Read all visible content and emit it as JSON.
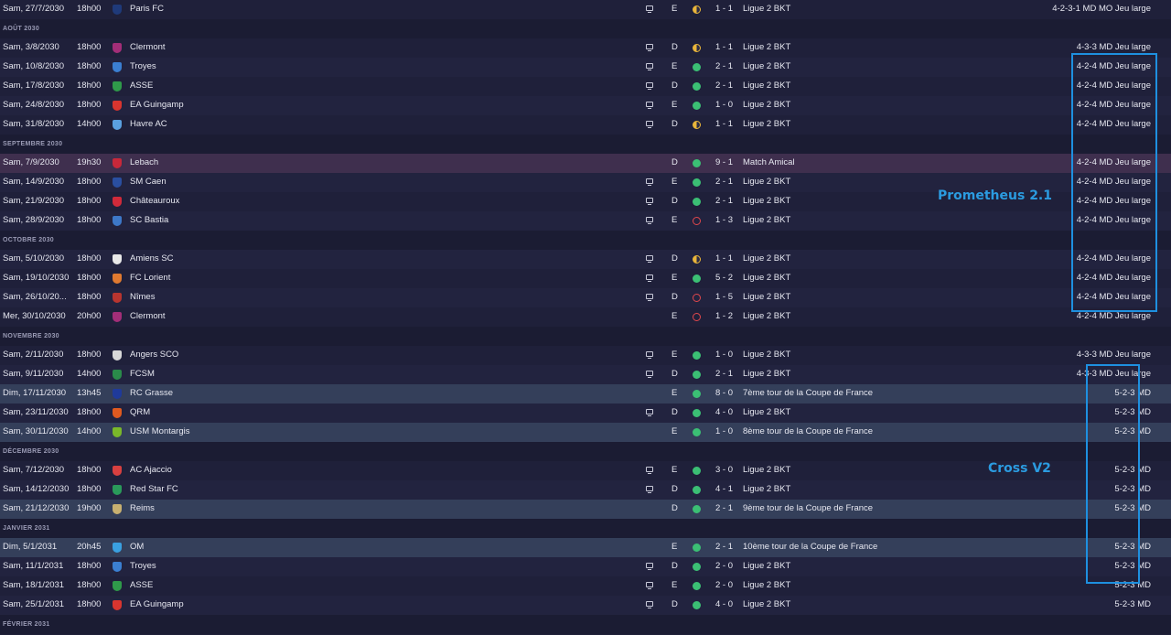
{
  "rows": [
    {
      "kind": "match",
      "date": "Sam, 27/7/2030",
      "time": "18h00",
      "crest": "#1f3a7a",
      "team": "Paris FC",
      "tv": true,
      "venue": "E",
      "result": "D",
      "score": "1 - 1",
      "comp": "Ligue 2 BKT",
      "tactic": "4-2-3-1 MD MO Jeu large"
    },
    {
      "kind": "month",
      "label": "AOÛT 2030"
    },
    {
      "kind": "match",
      "date": "Sam, 3/8/2030",
      "time": "18h00",
      "crest": "#a32e78",
      "team": "Clermont",
      "tv": true,
      "venue": "D",
      "result": "D",
      "score": "1 - 1",
      "comp": "Ligue 2 BKT",
      "tactic": "4-3-3 MD Jeu large"
    },
    {
      "kind": "match",
      "date": "Sam, 10/8/2030",
      "time": "18h00",
      "crest": "#3b7fd1",
      "team": "Troyes",
      "tv": true,
      "venue": "E",
      "result": "W",
      "score": "2 - 1",
      "comp": "Ligue 2 BKT",
      "tactic": "4-2-4 MD Jeu large"
    },
    {
      "kind": "match",
      "date": "Sam, 17/8/2030",
      "time": "18h00",
      "crest": "#2f9a4a",
      "team": "ASSE",
      "tv": true,
      "venue": "D",
      "result": "W",
      "score": "2 - 1",
      "comp": "Ligue 2 BKT",
      "tactic": "4-2-4 MD Jeu large"
    },
    {
      "kind": "match",
      "date": "Sam, 24/8/2030",
      "time": "18h00",
      "crest": "#d8352f",
      "team": "EA Guingamp",
      "tv": true,
      "venue": "E",
      "result": "W",
      "score": "1 - 0",
      "comp": "Ligue 2 BKT",
      "tactic": "4-2-4 MD Jeu large"
    },
    {
      "kind": "match",
      "date": "Sam, 31/8/2030",
      "time": "14h00",
      "crest": "#5aa0e0",
      "team": "Havre AC",
      "tv": true,
      "venue": "D",
      "result": "D",
      "score": "1 - 1",
      "comp": "Ligue 2 BKT",
      "tactic": "4-2-4 MD Jeu large"
    },
    {
      "kind": "month",
      "label": "SEPTEMBRE 2030"
    },
    {
      "kind": "match",
      "style": "friendly",
      "date": "Sam, 7/9/2030",
      "time": "19h30",
      "crest": "#c8283a",
      "team": "Lebach",
      "tv": false,
      "venue": "D",
      "result": "W",
      "score": "9 - 1",
      "comp": "Match Amical",
      "tactic": "4-2-4 MD Jeu large"
    },
    {
      "kind": "match",
      "date": "Sam, 14/9/2030",
      "time": "18h00",
      "crest": "#2a4fa0",
      "team": "SM Caen",
      "tv": true,
      "venue": "E",
      "result": "W",
      "score": "2 - 1",
      "comp": "Ligue 2 BKT",
      "tactic": "4-2-4 MD Jeu large"
    },
    {
      "kind": "match",
      "date": "Sam, 21/9/2030",
      "time": "18h00",
      "crest": "#d02a3a",
      "team": "Châteauroux",
      "tv": true,
      "venue": "D",
      "result": "W",
      "score": "2 - 1",
      "comp": "Ligue 2 BKT",
      "tactic": "4-2-4 MD Jeu large"
    },
    {
      "kind": "match",
      "date": "Sam, 28/9/2030",
      "time": "18h00",
      "crest": "#3d78c8",
      "team": "SC Bastia",
      "tv": true,
      "venue": "E",
      "result": "L",
      "score": "1 - 3",
      "comp": "Ligue 2 BKT",
      "tactic": "4-2-4 MD Jeu large"
    },
    {
      "kind": "month",
      "label": "OCTOBRE 2030"
    },
    {
      "kind": "match",
      "date": "Sam, 5/10/2030",
      "time": "18h00",
      "crest": "#e8e8e8",
      "team": "Amiens SC",
      "tv": true,
      "venue": "D",
      "result": "D",
      "score": "1 - 1",
      "comp": "Ligue 2 BKT",
      "tactic": "4-2-4 MD Jeu large"
    },
    {
      "kind": "match",
      "date": "Sam, 19/10/2030",
      "time": "18h00",
      "crest": "#e07a30",
      "team": "FC Lorient",
      "tv": true,
      "venue": "E",
      "result": "W",
      "score": "5 - 2",
      "comp": "Ligue 2 BKT",
      "tactic": "4-2-4 MD Jeu large"
    },
    {
      "kind": "match",
      "date": "Sam, 26/10/20...",
      "time": "18h00",
      "crest": "#b8352f",
      "team": "Nîmes",
      "tv": true,
      "venue": "D",
      "result": "L",
      "score": "1 - 5",
      "comp": "Ligue 2 BKT",
      "tactic": "4-2-4 MD Jeu large"
    },
    {
      "kind": "match",
      "date": "Mer, 30/10/2030",
      "time": "20h00",
      "crest": "#a32e78",
      "team": "Clermont",
      "tv": false,
      "venue": "E",
      "result": "L",
      "score": "1 - 2",
      "comp": "Ligue 2 BKT",
      "tactic": "4-2-4 MD Jeu large"
    },
    {
      "kind": "month",
      "label": "NOVEMBRE 2030"
    },
    {
      "kind": "match",
      "date": "Sam, 2/11/2030",
      "time": "18h00",
      "crest": "#d8d8d8",
      "team": "Angers SCO",
      "tv": true,
      "venue": "E",
      "result": "W",
      "score": "1 - 0",
      "comp": "Ligue 2 BKT",
      "tactic": "4-3-3 MD Jeu large"
    },
    {
      "kind": "match",
      "date": "Sam, 9/11/2030",
      "time": "14h00",
      "crest": "#2a8a4a",
      "team": "FCSM",
      "tv": true,
      "venue": "D",
      "result": "W",
      "score": "2 - 1",
      "comp": "Ligue 2 BKT",
      "tactic": "4-3-3 MD Jeu large"
    },
    {
      "kind": "match",
      "style": "cup",
      "date": "Dim, 17/11/2030",
      "time": "13h45",
      "crest": "#1f3a9a",
      "team": "RC Grasse",
      "tv": false,
      "venue": "E",
      "result": "W",
      "score": "8 - 0",
      "comp": "7ème tour de la Coupe de France",
      "tactic": "5-2-3 MD"
    },
    {
      "kind": "match",
      "date": "Sam, 23/11/2030",
      "time": "18h00",
      "crest": "#e05a20",
      "team": "QRM",
      "tv": true,
      "venue": "D",
      "result": "W",
      "score": "4 - 0",
      "comp": "Ligue 2 BKT",
      "tactic": "5-2-3 MD"
    },
    {
      "kind": "match",
      "style": "cup",
      "date": "Sam, 30/11/2030",
      "time": "14h00",
      "crest": "#7ab82a",
      "team": "USM Montargis",
      "tv": false,
      "venue": "E",
      "result": "W",
      "score": "1 - 0",
      "comp": "8ème tour de la Coupe de France",
      "tactic": "5-2-3 MD"
    },
    {
      "kind": "month",
      "label": "DÉCEMBRE 2030"
    },
    {
      "kind": "match",
      "date": "Sam, 7/12/2030",
      "time": "18h00",
      "crest": "#d84040",
      "team": "AC Ajaccio",
      "tv": true,
      "venue": "E",
      "result": "W",
      "score": "3 - 0",
      "comp": "Ligue 2 BKT",
      "tactic": "5-2-3 MD"
    },
    {
      "kind": "match",
      "date": "Sam, 14/12/2030",
      "time": "18h00",
      "crest": "#2a9a5a",
      "team": "Red Star FC",
      "tv": true,
      "venue": "D",
      "result": "W",
      "score": "4 - 1",
      "comp": "Ligue 2 BKT",
      "tactic": "5-2-3 MD"
    },
    {
      "kind": "match",
      "style": "cup",
      "date": "Sam, 21/12/2030",
      "time": "19h00",
      "crest": "#c8b070",
      "team": "Reims",
      "tv": false,
      "venue": "D",
      "result": "W",
      "score": "2 - 1",
      "comp": "9ème tour de la Coupe de France",
      "tactic": "5-2-3 MD"
    },
    {
      "kind": "month",
      "label": "JANVIER 2031"
    },
    {
      "kind": "match",
      "style": "cup",
      "date": "Dim, 5/1/2031",
      "time": "20h45",
      "crest": "#3aa0e0",
      "team": "OM",
      "tv": false,
      "venue": "E",
      "result": "W",
      "score": "2 - 1",
      "comp": "10ème tour de la Coupe de France",
      "tactic": "5-2-3 MD"
    },
    {
      "kind": "match",
      "date": "Sam, 11/1/2031",
      "time": "18h00",
      "crest": "#3b7fd1",
      "team": "Troyes",
      "tv": true,
      "venue": "D",
      "result": "W",
      "score": "2 - 0",
      "comp": "Ligue 2 BKT",
      "tactic": "5-2-3 MD"
    },
    {
      "kind": "match",
      "date": "Sam, 18/1/2031",
      "time": "18h00",
      "crest": "#2f9a4a",
      "team": "ASSE",
      "tv": true,
      "venue": "E",
      "result": "W",
      "score": "2 - 0",
      "comp": "Ligue 2 BKT",
      "tactic": "5-2-3 MD"
    },
    {
      "kind": "match",
      "date": "Sam, 25/1/2031",
      "time": "18h00",
      "crest": "#d8352f",
      "team": "EA Guingamp",
      "tv": true,
      "venue": "D",
      "result": "W",
      "score": "4 - 0",
      "comp": "Ligue 2 BKT",
      "tactic": "5-2-3 MD"
    },
    {
      "kind": "month",
      "label": "FÉVRIER 2031"
    }
  ],
  "annotations": {
    "prometheus_label": "Prometheus 2.1",
    "cross_label": "Cross V2",
    "color": "#1e90e0"
  },
  "colors": {
    "win": "#3bbf74",
    "draw": "#e9b53a",
    "loss": "#e0474c",
    "cup_row": "#343f5a",
    "friendly_row": "#3f2f4e"
  }
}
